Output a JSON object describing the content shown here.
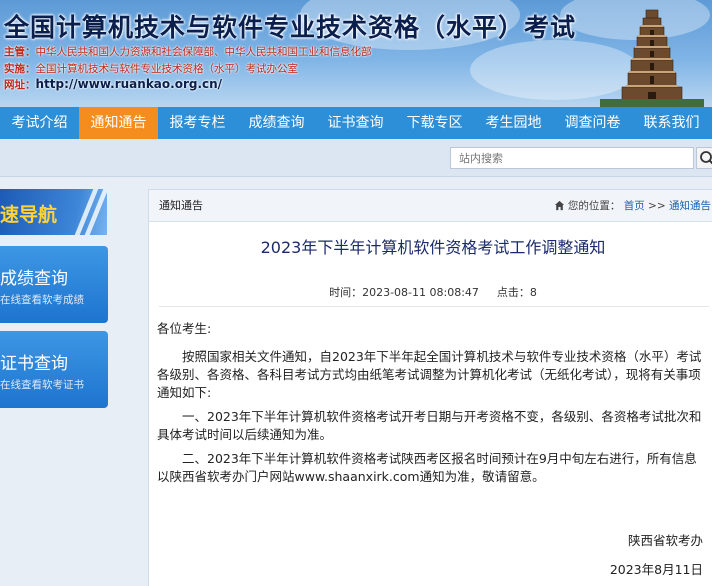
{
  "banner": {
    "title": "全国计算机技术与软件专业技术资格（水平）考试",
    "sponsor_label": "主管：",
    "sponsor_value": "中华人民共和国人力资源和社会保障部、中华人民共和国工业和信息化部",
    "organizer_label": "实施：",
    "organizer_value": "全国计算机技术与软件专业技术资格（水平）考试办公室",
    "website_label": "网址：",
    "website_value": "http://www.ruankao.org.cn/"
  },
  "nav": {
    "items": [
      "考试介绍",
      "通知通告",
      "报考专栏",
      "成绩查询",
      "证书查询",
      "下载专区",
      "考生园地",
      "调查问卷",
      "联系我们"
    ],
    "active_index": 1
  },
  "search": {
    "placeholder": "站内搜索"
  },
  "sidebar": {
    "header": "速导航",
    "cards": [
      {
        "title": "成绩查询",
        "subtitle": "在线查看软考成绩"
      },
      {
        "title": "证书查询",
        "subtitle": "在线查看软考证书"
      }
    ]
  },
  "panel": {
    "tab_label": "通知通告",
    "breadcrumb_prefix": "您的位置：",
    "breadcrumb_home": "首页",
    "breadcrumb_sep": ">>",
    "breadcrumb_current": "通知通告"
  },
  "article": {
    "title": "2023年下半年计算机软件资格考试工作调整通知",
    "time_label": "时间：",
    "time_value": "2023-08-11 08:08:47",
    "clicks_label": "点击：",
    "clicks_value": "8",
    "greeting": "各位考生:",
    "paragraphs": [
      "按照国家相关文件通知，自2023年下半年起全国计算机技术与软件专业技术资格（水平）考试各级别、各资格、各科目考试方式均由纸笔考试调整为计算机化考试（无纸化考试），现将有关事项通知如下:",
      "一、2023年下半年计算机软件资格考试开考日期与开考资格不变，各级别、各资格考试批次和具体考试时间以后续通知为准。",
      "二、2023年下半年计算机软件资格考试陕西考区报名时间预计在9月中旬左右进行，所有信息以陕西省软考办门户网站www.shaanxirk.com通知为准，敬请留意。"
    ],
    "signer": "陕西省软考办",
    "date": "2023年8月11日"
  },
  "colors": {
    "nav_bg": "#2d8fd8",
    "nav_active": "#f58c1e",
    "title_blue": "#1a2a6c",
    "banner_red": "#c0281a"
  },
  "icons": {
    "search": "search-icon",
    "home": "home-icon",
    "pagoda": "pagoda-illustration"
  }
}
